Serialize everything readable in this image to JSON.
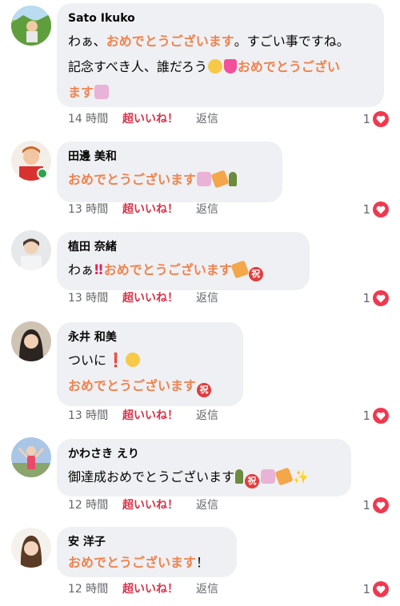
{
  "ui": {
    "like_label": "超いいね！",
    "reply_label": "返信"
  },
  "comments": [
    {
      "name": "Sato Ikuko",
      "line1": "わぁ、",
      "line1_hl": "おめでとうございます",
      "line1_tail": "。すごい事ですね。",
      "line2": "記念すべき人、誰だろう",
      "line2_hl": "おめでとうござい",
      "line3_hl": "ます",
      "time": "14 時間",
      "reactions": "1"
    },
    {
      "name": "田邊 美和",
      "text_hl": "おめでとうございます",
      "time": "13 時間",
      "reactions": "1"
    },
    {
      "name": "植田 奈緒",
      "text": "わぁ",
      "mark": "‼",
      "text_hl": "おめでとうございます",
      "iwai": "祝",
      "time": "13 時間",
      "reactions": "1"
    },
    {
      "name": "永井 和美",
      "line1": "ついに",
      "mark": "❗",
      "line2_hl": "おめでとうございます",
      "iwai": "祝",
      "time": "13 時間",
      "reactions": "1"
    },
    {
      "name": "かわさき えり",
      "text": "御達成おめでとうございます",
      "iwai": "祝",
      "sparkle": "✨",
      "time": "12 時間",
      "reactions": "1"
    },
    {
      "name": "安 洋子",
      "text_hl": "おめでとうございます",
      "text_tail": "！",
      "time": "12 時間",
      "reactions": "1"
    }
  ]
}
